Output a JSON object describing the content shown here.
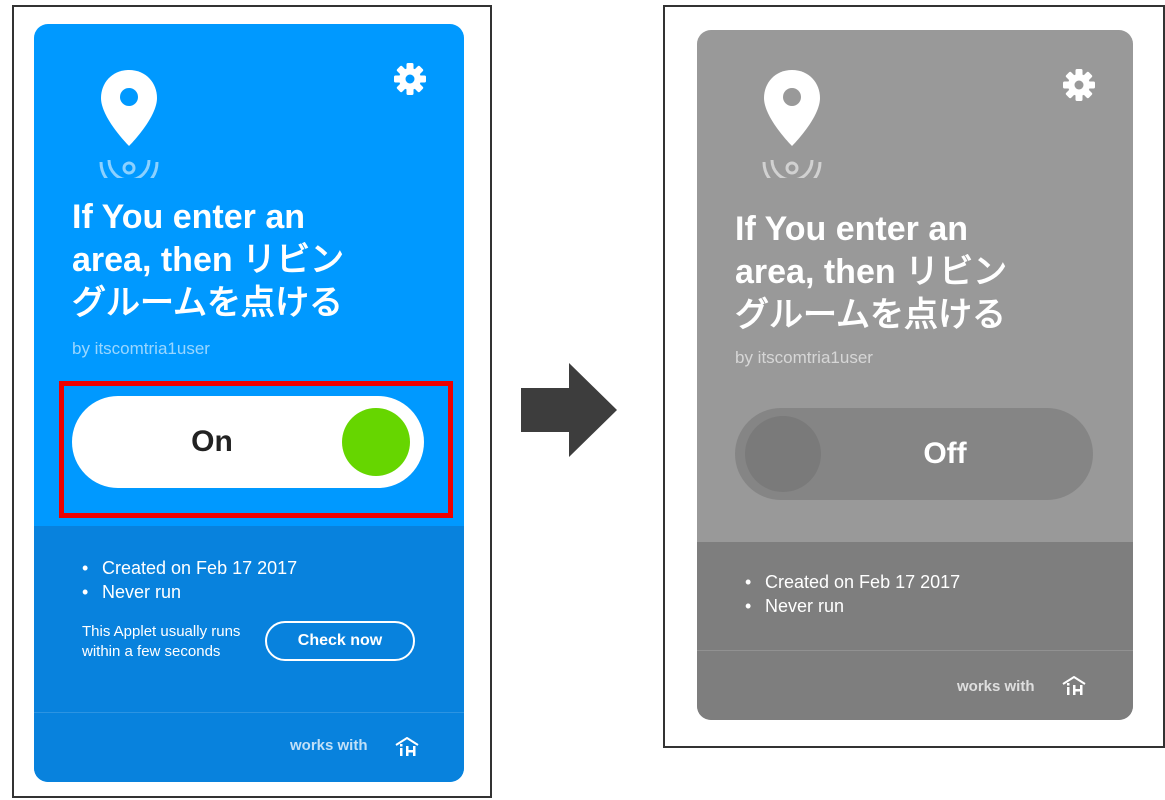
{
  "colors": {
    "on_card": "#0099ff",
    "on_card_bottom": "#0882dd",
    "off_card": "#999999",
    "off_card_bottom": "#7e7e7e",
    "knob_on": "#66d600",
    "highlight": "#ee0000",
    "arrow": "#3d3d3d"
  },
  "before": {
    "title": "If You enter an\narea, then リビン\nグルームを点ける",
    "author": "by itscomtria1user",
    "toggle_label": "On",
    "details": [
      "Created on Feb 17 2017",
      "Never run"
    ],
    "usually_text": "This Applet usually runs within a few seconds",
    "check_now": "Check now",
    "works_with": "works with",
    "icons": {
      "location": "location-pin-icon",
      "settings": "gear-icon",
      "service": "ih-logo-icon"
    }
  },
  "after": {
    "title": "If You enter an\narea, then リビン\nグルームを点ける",
    "author": "by itscomtria1user",
    "toggle_label": "Off",
    "details": [
      "Created on Feb 17 2017",
      "Never run"
    ],
    "works_with": "works with",
    "icons": {
      "location": "location-pin-icon",
      "settings": "gear-icon",
      "service": "ih-logo-icon"
    }
  },
  "transition_icon": "right-arrow-icon"
}
